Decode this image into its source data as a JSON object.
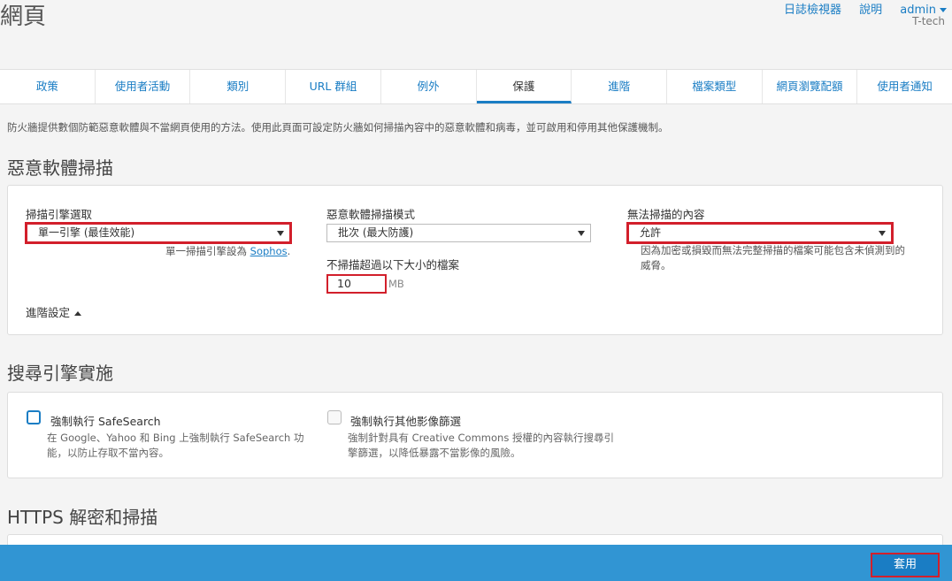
{
  "header": {
    "title": "網頁",
    "links": {
      "log_viewer": "日誌檢視器",
      "help": "說明",
      "user": "admin"
    },
    "org": "T-tech"
  },
  "tabs": [
    "政策",
    "使用者活動",
    "類別",
    "URL 群組",
    "例外",
    "保護",
    "進階",
    "檔案類型",
    "網頁瀏覽配額",
    "使用者通知"
  ],
  "active_tab": "保護",
  "intro": "防火牆提供數個防範惡意軟體與不當網頁使用的方法。使用此頁面可設定防火牆如何掃描內容中的惡意軟體和病毒，並可啟用和停用其他保護機制。",
  "malware": {
    "title": "惡意軟體掃描",
    "engine": {
      "label": "掃描引擎選取",
      "value": "單一引擎 (最佳效能)",
      "hint_prefix": "單一掃描引擎設為 ",
      "hint_link": "Sophos",
      "hint_suffix": "."
    },
    "mode": {
      "label": "惡意軟體掃描模式",
      "value": "批次 (最大防護)"
    },
    "size": {
      "label": "不掃描超過以下大小的檔案",
      "value": "10",
      "unit": "MB"
    },
    "unscannable": {
      "label": "無法掃描的內容",
      "value": "允許",
      "hint": "因為加密或損毀而無法完整掃描的檔案可能包含未偵測到的威脅。"
    },
    "advanced": "進階設定"
  },
  "search": {
    "title": "搜尋引擎實施",
    "safesearch": {
      "label": "強制執行 SafeSearch",
      "desc_line1": "在 Google、Yahoo 和 Bing 上強制執行 SafeSearch 功",
      "desc_line2": "能，以防止存取不當內容。"
    },
    "image": {
      "label": "強制執行其他影像篩選",
      "desc_line1": "強制針對具有 Creative Commons 授權的內容執行搜尋引",
      "desc_line2": "擎篩選，以降低暴露不當影像的風險。"
    }
  },
  "https": {
    "title": "HTTPS 解密和掃描"
  },
  "footer": {
    "apply": "套用"
  },
  "colors": {
    "accent": "#1a7dc4",
    "footer_bar": "#3195d3",
    "highlight": "#d21f2b"
  }
}
